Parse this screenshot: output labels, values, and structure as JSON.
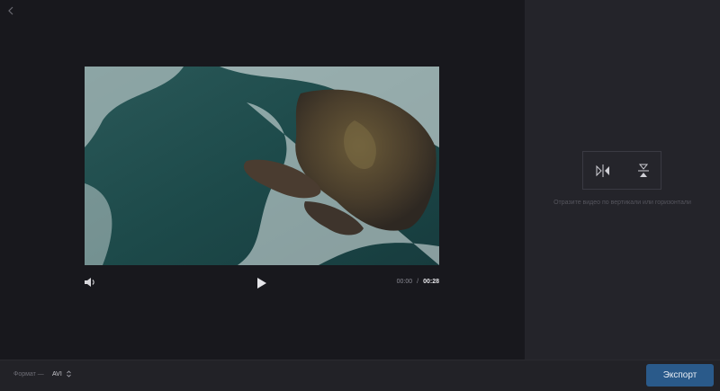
{
  "player": {
    "time_current": "00:00",
    "time_separator": "/",
    "time_duration": "00:28"
  },
  "flip_panel": {
    "description": "Отразите видео по вертикали или горизонтали"
  },
  "footer": {
    "format_label": "Формат —",
    "format_value": "AVI",
    "export_label": "Экспорт"
  },
  "colors": {
    "accent": "#2a5a8a",
    "background": "#18181d",
    "side_panel": "#24242a"
  }
}
